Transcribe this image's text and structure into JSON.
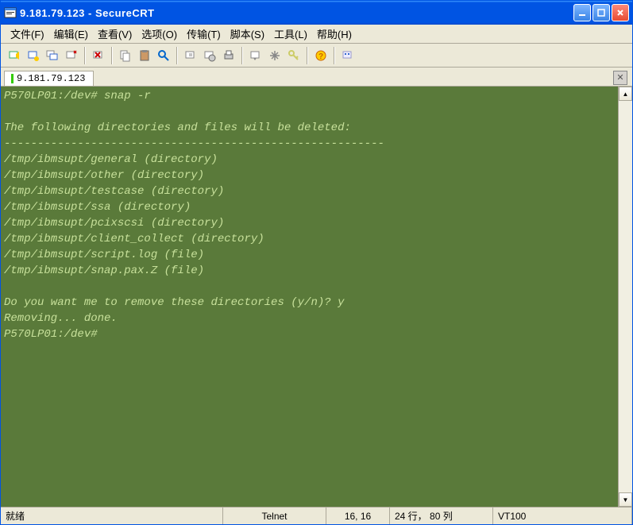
{
  "window": {
    "title": "9.181.79.123 - SecureCRT"
  },
  "menubar": {
    "items": [
      "文件(F)",
      "编辑(E)",
      "查看(V)",
      "选项(O)",
      "传输(T)",
      "脚本(S)",
      "工具(L)",
      "帮助(H)"
    ]
  },
  "tabs": {
    "active": "9.181.79.123"
  },
  "terminal": {
    "lines": [
      "P570LP01:/dev# snap -r",
      "",
      "The following directories and files will be deleted:",
      "---------------------------------------------------------",
      "/tmp/ibmsupt/general (directory)",
      "/tmp/ibmsupt/other (directory)",
      "/tmp/ibmsupt/testcase (directory)",
      "/tmp/ibmsupt/ssa (directory)",
      "/tmp/ibmsupt/pcixscsi (directory)",
      "/tmp/ibmsupt/client_collect (directory)",
      "/tmp/ibmsupt/script.log (file)",
      "/tmp/ibmsupt/snap.pax.Z (file)",
      "",
      "Do you want me to remove these directories (y/n)? y",
      "Removing... done.",
      "P570LP01:/dev#"
    ]
  },
  "statusbar": {
    "ready": "就绪",
    "protocol": "Telnet",
    "cursor": "16,  16",
    "size": "24 行， 80 列",
    "emulation": "VT100"
  }
}
